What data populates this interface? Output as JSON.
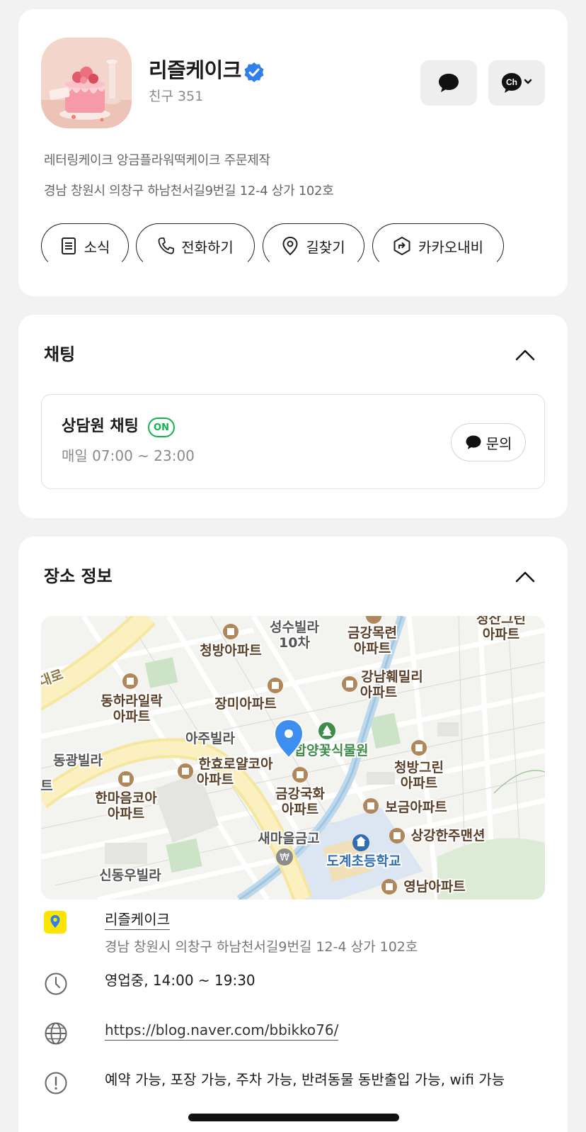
{
  "profile": {
    "name": "리즐케이크",
    "friends_label": "친구",
    "friends_count": "351",
    "description": "레터링케이크 앙금플라워떡케이크 주문제작",
    "address": "경남 창원시 의창구 하남천서길9번길 12-4 상가 102호",
    "actions": [
      {
        "label": "소식",
        "icon": "document-icon"
      },
      {
        "label": "전화하기",
        "icon": "phone-icon"
      },
      {
        "label": "길찾기",
        "icon": "location-pin-icon"
      },
      {
        "label": "카카오내비",
        "icon": "navigation-icon"
      }
    ],
    "channel_button_text": "Ch"
  },
  "chat": {
    "section_title": "채팅",
    "title": "상담원 채팅",
    "status_badge": "ON",
    "hours": "매일 07:00 ~ 23:00",
    "inquiry_label": "문의"
  },
  "place": {
    "section_title": "장소 정보",
    "map_labels": [
      {
        "text": "성수빌라",
        "kind": "plain"
      },
      {
        "text": "10차",
        "kind": "plain"
      },
      {
        "text": "금강목련",
        "kind": "apt"
      },
      {
        "text": "아파트",
        "kind": "apt"
      },
      {
        "text": "청방아파트",
        "kind": "apt"
      },
      {
        "text": "강남훼밀리",
        "kind": "apt"
      },
      {
        "text": "아파트",
        "kind": "apt"
      },
      {
        "text": "동하라일락",
        "kind": "apt"
      },
      {
        "text": "아파트",
        "kind": "apt"
      },
      {
        "text": "장미아파트",
        "kind": "apt"
      },
      {
        "text": "아주빌라",
        "kind": "plain"
      },
      {
        "text": "동광빌라",
        "kind": "plain"
      },
      {
        "text": "한효로얄코아",
        "kind": "apt"
      },
      {
        "text": "아파트",
        "kind": "apt"
      },
      {
        "text": "한마음코아",
        "kind": "apt"
      },
      {
        "text": "아파트",
        "kind": "apt"
      },
      {
        "text": "금강국화",
        "kind": "apt"
      },
      {
        "text": "아파트",
        "kind": "apt"
      },
      {
        "text": "청방그린",
        "kind": "apt"
      },
      {
        "text": "아파트",
        "kind": "apt"
      },
      {
        "text": "보금아파트",
        "kind": "apt"
      },
      {
        "text": "새마을금고",
        "kind": "plain"
      },
      {
        "text": "상강한주맨션",
        "kind": "apt"
      },
      {
        "text": "도계초등학교",
        "kind": "school"
      },
      {
        "text": "신동우빌라",
        "kind": "plain"
      },
      {
        "text": "영남아파트",
        "kind": "apt"
      },
      {
        "text": "합양꽃식물원",
        "kind": "park"
      },
      {
        "text": "아파트",
        "kind": "apt"
      },
      {
        "text": "대로",
        "kind": "road"
      },
      {
        "text": "트",
        "kind": "plain"
      },
      {
        "text": "청산그린",
        "kind": "apt"
      }
    ],
    "place_name": "리즐케이크",
    "place_address": "경남 창원시 의창구 하남천서길9번길 12-4 상가 102호",
    "hours_status": "영업중, 14:00 ~ 19:30",
    "website": "https://blog.naver.com/bbikko76/",
    "amenities": "예약 가능, 포장 가능, 주차 가능, 반려동물 동반출입 가능, wifi 가능"
  },
  "colors": {
    "verified_blue": "#2f80ed",
    "on_green": "#12b447",
    "kakao_yellow": "#fee500",
    "map_pin_blue": "#3d8ef0",
    "map_apt_brown": "#b0875a",
    "map_park_green": "#3e8b4a",
    "map_school_blue": "#2f6db5"
  }
}
